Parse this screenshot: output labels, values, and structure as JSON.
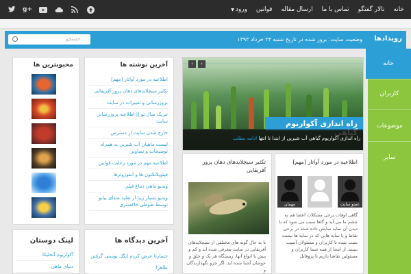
{
  "topbar": {
    "nav": [
      "خانه",
      "تالار گفتگو",
      "تماس با ما",
      "ارسال مقاله",
      "قوانین",
      "ورود"
    ],
    "socials": [
      "arrow-circle-icon",
      "rss-icon",
      "cloud-icon",
      "youtube-icon",
      "google-plus-icon",
      "twitter-icon"
    ]
  },
  "newsbar": {
    "title": "رویدادها",
    "text": "وضعیت سایت: بروز شده در تاریخ شنبه ۲۴ خرداد ۱۳۹۳",
    "search_placeholder": "جستجو ..."
  },
  "vmenu": {
    "items": [
      "خانه",
      "کاربران",
      "موضوعات",
      "سایر"
    ],
    "active_color": "#2b9fd6",
    "color": "#8cc63f"
  },
  "slider": {
    "title": "راه اندازی آکواریوم گیاهی",
    "caption": "راه اندازی آکواریوم گیاهی آب شیرین از ابتدا تا انتها",
    "more": "ادامه مطلب",
    "prev": "‹",
    "next": "›"
  },
  "latest": {
    "title": "آخرین نوشته ها",
    "items": [
      "اطلاعیه در مورد آواتار [مهم]",
      "تکثیر سیچلایدهای دهان پرور آفریقایی",
      "بروزرسانی و تغییرات در سایت",
      "تبریک سال نو || اطلاعیه بروزرسانی سایت",
      "خارج شدن سایت از دسترس",
      "لیست ماهیان آب شیرین به همراه توضیحات و تصاویر",
      "اطلاعیه مهم در مورد رعایت قوانین",
      "فیتوپلانکتون ها و انفوزوئرها",
      "ویدیو ماهی دماغ فیلی",
      "ویدیو بسیار زیبا از تقلید صدای پیانو توسط طوطی خاکستری"
    ]
  },
  "recent_visits": {
    "title": "آخرین دیدگاه ها",
    "items": [
      "جسارتا عرض کردم انگل پوستی گرفتن",
      "ظاهرا"
    ]
  },
  "popular": {
    "title": "محبوبترین ها"
  },
  "friends": {
    "title": "لینک دوستان",
    "items": [
      "آکواریوم آنجلیکا",
      "دنیای ماهی"
    ]
  },
  "post_avatar": {
    "title": "اطلاعیه در مورد آواتار [مهم]",
    "avatars": [
      "عضو سایت",
      "مهمان"
    ],
    "text": "گاهی اوقات برخی مشکلات اعضا هم به چشم ما می آید و گاها سبب می شود که با دیدن آن نمایه نمایش داده شده در برخی نقاط و یا نمایه هایی که در نمایه ها نیست سبب شده تا کاربران و مسئولان آسیب ببینند. از اینجا از همه شما کاربران و مسئولین تقاضا داریم تا پروفایل"
  },
  "post_fish": {
    "title": "تکثیر سیچلایدهای دهان پرور آفریقایی",
    "text": "تا به حال گونه های مختلفی از سیچلایدهای آفریقایی در سایت معرفی شده اند و کم و بیش با انواع آنها، زیستگاه هر یک و خلق و خوشان آشنا شده اید. اگر جزو نگهدارندگان و"
  }
}
